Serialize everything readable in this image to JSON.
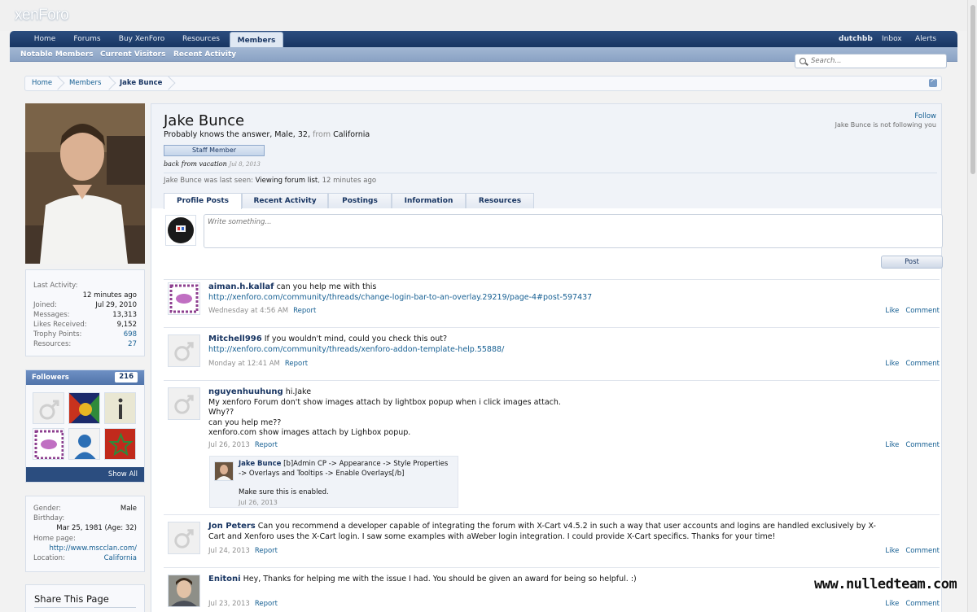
{
  "logo": "xenForo",
  "nav": {
    "tabs": [
      "Home",
      "Forums",
      "Buy XenForo",
      "Resources",
      "Members"
    ],
    "active_tab": "Members",
    "user": "dutchbb",
    "inbox": "Inbox",
    "alerts": "Alerts"
  },
  "subnav": [
    "Notable Members",
    "Current Visitors",
    "Recent Activity"
  ],
  "search": {
    "placeholder": "Search..."
  },
  "breadcrumb": [
    "Home",
    "Members",
    "Jake Bunce"
  ],
  "sidebar": {
    "stats": [
      {
        "label": "Last Activity:",
        "value": "12 minutes ago"
      },
      {
        "label": "Joined:",
        "value": "Jul 29, 2010"
      },
      {
        "label": "Messages:",
        "value": "13,313"
      },
      {
        "label": "Likes Received:",
        "value": "9,152"
      },
      {
        "label": "Trophy Points:",
        "value": "698"
      },
      {
        "label": "Resources:",
        "value": "27"
      }
    ],
    "followers_title": "Followers",
    "followers_count": "216",
    "show_all": "Show All",
    "info": [
      {
        "label": "Gender:",
        "value": "Male"
      },
      {
        "label": "Birthday:",
        "value": "Mar 25, 1981 (Age: 32)"
      },
      {
        "label": "Home page:",
        "value": "http://www.mscclan.com/"
      },
      {
        "label": "Location:",
        "value": "California"
      }
    ],
    "share_title": "Share This Page"
  },
  "profile": {
    "name": "Jake Bunce",
    "title": "Probably knows the answer",
    "gender": "Male",
    "age": "32",
    "from_label": "from",
    "location": "California",
    "badge": "Staff Member",
    "status": "back from vacation",
    "status_date": "Jul 8, 2013",
    "last_seen_label": "Jake Bunce was last seen:",
    "last_seen_action": "Viewing forum list",
    "last_seen_time": "12 minutes ago",
    "follow": "Follow",
    "follow_note": "Jake Bunce is not following you"
  },
  "tabs": [
    "Profile Posts",
    "Recent Activity",
    "Postings",
    "Information",
    "Resources"
  ],
  "active_tab": "Profile Posts",
  "composer": {
    "placeholder": "Write something...",
    "post_label": "Post"
  },
  "messages": [
    {
      "author": "aiman.h.kallaf",
      "lines": [
        "can you help me with this"
      ],
      "link": "http://xenforo.com/community/threads/change-login-bar-to-an-overlay.29219/page-4#post-597437",
      "date": "Wednesday at 4:56 AM"
    },
    {
      "author": "Mitchell996",
      "lines": [
        "If you wouldn't mind, could you check this out?"
      ],
      "link": "http://xenforo.com/community/threads/xenforo-addon-template-help.55888/",
      "date": "Monday at 12:41 AM"
    },
    {
      "author": "nguyenhuuhung",
      "lines": [
        "hi.Jake",
        "My xenforo Forum don't show images attach by lightbox popup when i click images attach.",
        "Why??",
        "can you help me??",
        "xenforo.com show images attach by Lighbox popup."
      ],
      "date": "Jul 26, 2013"
    },
    {
      "author": "Jon Peters",
      "lines": [
        "Can you recommend a developer capable of integrating the forum with X-Cart v4.5.2 in such a way that user accounts and logins are handled exclusively by X-",
        "Cart and Xenforo uses the X-Cart login. I saw some examples with aWeber login integration. I could provide X-Cart specifics. Thanks for your time!"
      ],
      "date": "Jul 24, 2013"
    },
    {
      "author": "Enitoni",
      "lines": [
        "Hey, Thanks for helping me with the issue I had. You should be given an award for being so helpful. :)"
      ],
      "date": "Jul 23, 2013"
    }
  ],
  "comment": {
    "author": "Jake Bunce",
    "lines": [
      "[b]Admin CP -> Appearance -> Style Properties",
      "-> Overlays and Tooltips -> Enable Overlays[/b]"
    ],
    "body": "Make sure this is enabled.",
    "date": "Jul 26, 2013"
  },
  "actions": {
    "report": "Report",
    "like": "Like",
    "comment": "Comment"
  },
  "watermark": "www.nulledteam.com",
  "colors": {
    "nav": "#183562",
    "link": "#176093",
    "author": "#183562",
    "page_bg": "#f2f2f2"
  }
}
